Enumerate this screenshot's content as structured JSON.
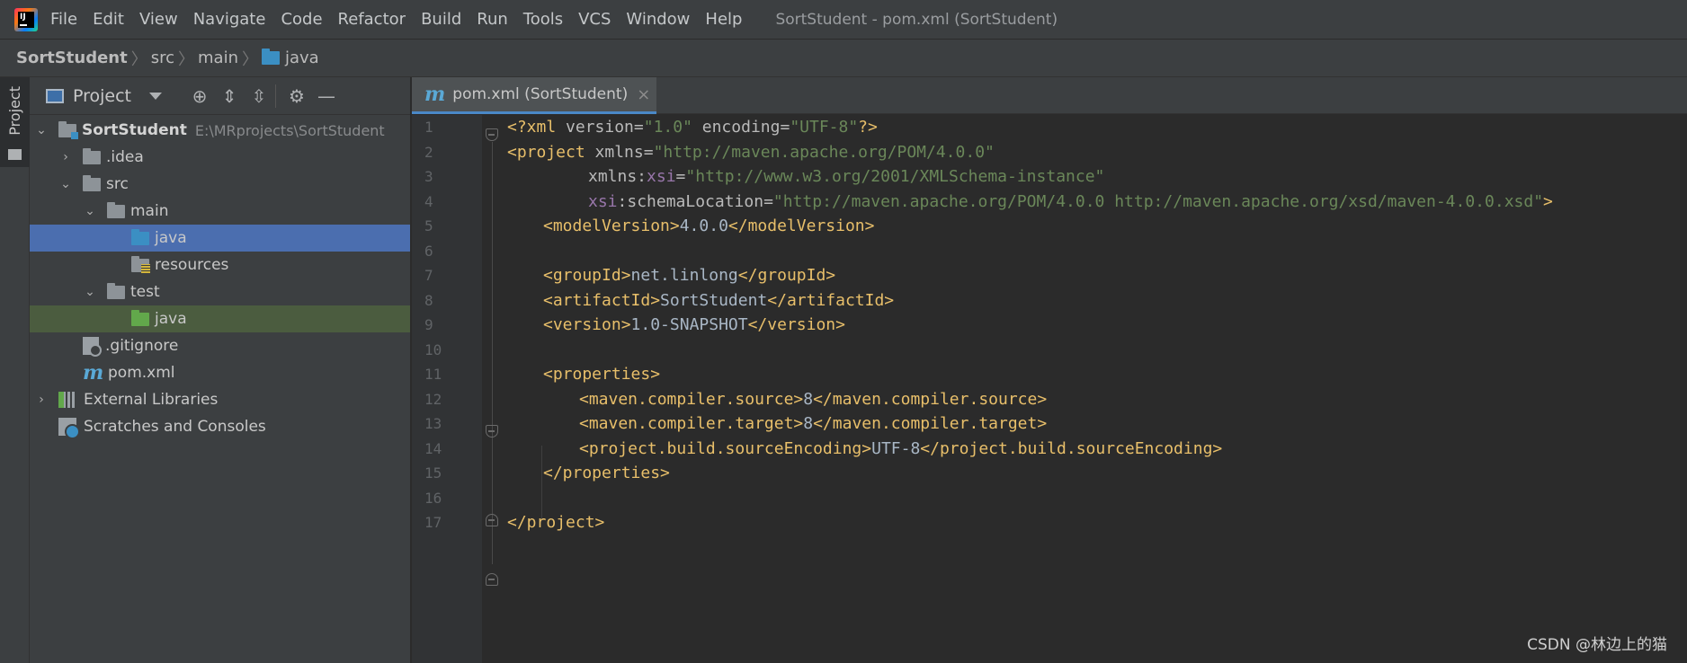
{
  "app_title": "SortStudent - pom.xml (SortStudent)",
  "menu": [
    "File",
    "Edit",
    "View",
    "Navigate",
    "Code",
    "Refactor",
    "Build",
    "Run",
    "Tools",
    "VCS",
    "Window",
    "Help"
  ],
  "breadcrumb": [
    "SortStudent",
    "src",
    "main",
    "java"
  ],
  "toolstrip": {
    "project_tab": "Project"
  },
  "project_panel": {
    "title": "Project",
    "tree": {
      "root_label": "SortStudent",
      "root_path": "E:\\MRprojects\\SortStudent",
      "idea": ".idea",
      "src": "src",
      "main": "main",
      "main_java": "java",
      "resources": "resources",
      "test": "test",
      "test_java": "java",
      "gitignore": ".gitignore",
      "pom": "pom.xml",
      "external_libraries": "External Libraries",
      "scratches": "Scratches and Consoles"
    }
  },
  "editor": {
    "tab_label": "pom.xml (SortStudent)",
    "tab_icon": "m",
    "line_numbers": [
      "1",
      "2",
      "3",
      "4",
      "5",
      "6",
      "7",
      "8",
      "9",
      "10",
      "11",
      "12",
      "13",
      "14",
      "15",
      "16",
      "17"
    ],
    "code": {
      "l1": [
        "<?xml ",
        "version",
        "=",
        "\"1.0\"",
        " encoding",
        "=",
        "\"UTF-8\"",
        "?>"
      ],
      "l2": [
        "<project ",
        "xmlns",
        "=",
        "\"http://maven.apache.org/POM/4.0.0\""
      ],
      "l3": [
        "xmlns:",
        "xsi",
        "=",
        "\"http://www.w3.org/2001/XMLSchema-instance\""
      ],
      "l4": [
        "xsi",
        ":schemaLocation",
        "=",
        "\"http://maven.apache.org/POM/4.0.0 http://maven.apache.org/xsd/maven-4.0.0.xsd\"",
        ">"
      ],
      "l5": [
        "<modelVersion>",
        "4.0.0",
        "</modelVersion>"
      ],
      "l7": [
        "<groupId>",
        "net.linlong",
        "</groupId>"
      ],
      "l8": [
        "<artifactId>",
        "SortStudent",
        "</artifactId>"
      ],
      "l9": [
        "<version>",
        "1.0-SNAPSHOT",
        "</version>"
      ],
      "l11": [
        "<properties>"
      ],
      "l12": [
        "<maven.compiler.source>",
        "8",
        "</maven.compiler.source>"
      ],
      "l13": [
        "<maven.compiler.target>",
        "8",
        "</maven.compiler.target>"
      ],
      "l14": [
        "<project.build.sourceEncoding>",
        "UTF-8",
        "</project.build.sourceEncoding>"
      ],
      "l15": [
        "</properties>"
      ],
      "l17": [
        "</project>"
      ]
    }
  },
  "watermark": "CSDN @林边上的猫",
  "colors": {
    "tag": "#e8bf6a",
    "attribute": "#bababa",
    "namespace": "#9876aa",
    "string": "#6a8759",
    "text": "#a9b7c6",
    "selection": "#4b6eaf",
    "folder_source": "#3b8fc3",
    "folder_test": "#62a84b"
  }
}
